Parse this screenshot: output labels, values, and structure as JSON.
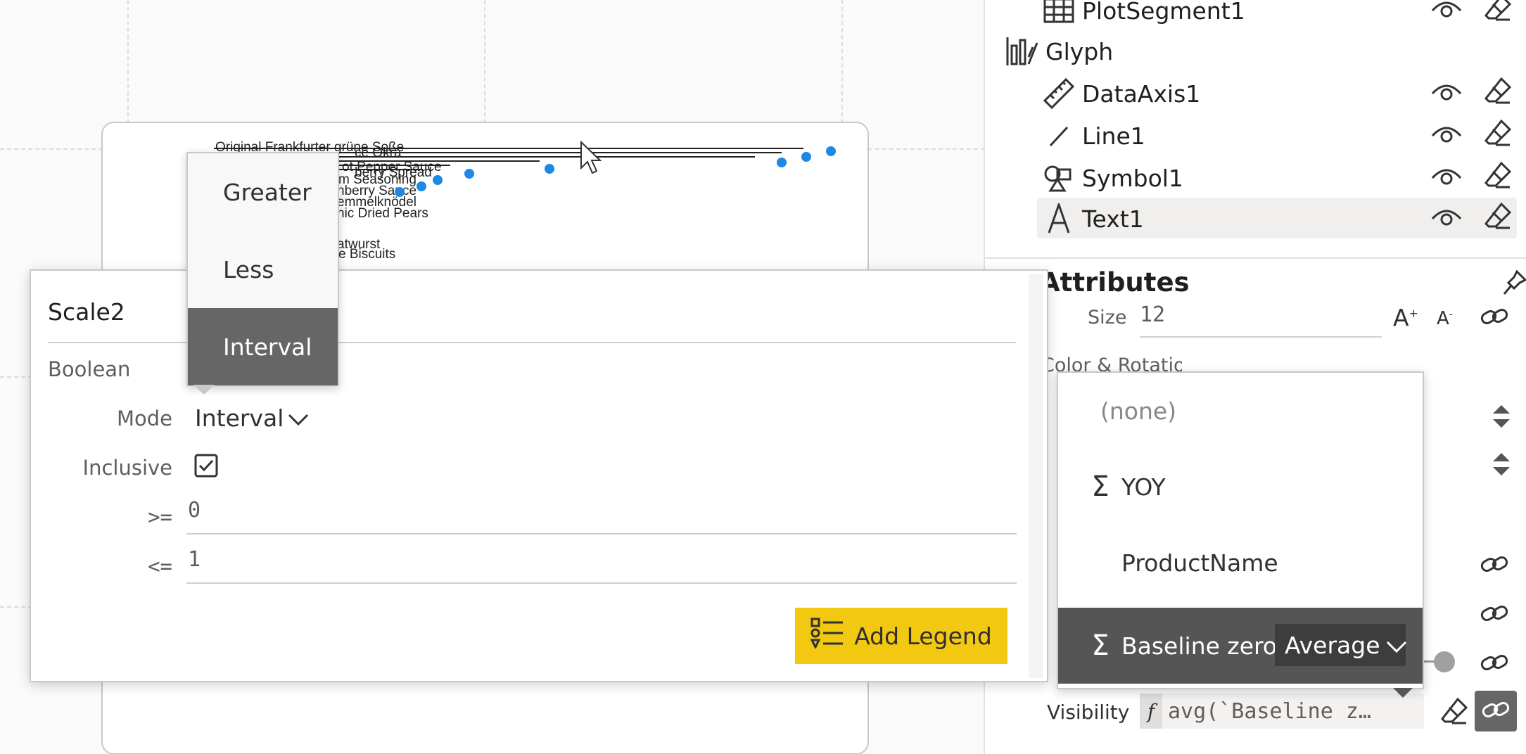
{
  "chart": {
    "labels": [
      "Original Frankfurter grüne Soße",
      "Louisiana Hot Spiced Okra",
      "Louisiana Fiery Hot Pepper Sauce",
      "Northwoods Cranberry Sauce",
      "Cajun Seasoning",
      "Cranberry Sauce",
      "Gudbrandsdalsost Semmelknödel",
      "Organic Dried Pears",
      "Thüringer Rostbratwurst",
      "Shortbread Biscuits"
    ],
    "visible_labels": [
      "Original Frankfurter grüne Soße",
      "ce Okra",
      "ot Pepper Sauce",
      "berry Spread",
      "m Seasoning",
      "nberry Sauce",
      "emmelknödel",
      "nic Dried Pears",
      "atwurst",
      "e Biscuits"
    ]
  },
  "tree": {
    "plot_segment": "PlotSegment1",
    "glyph": "Glyph",
    "items": [
      {
        "label": "DataAxis1",
        "icon": "ruler-icon"
      },
      {
        "label": "Line1",
        "icon": "line-icon"
      },
      {
        "label": "Symbol1",
        "icon": "shapes-icon"
      },
      {
        "label": "Text1",
        "icon": "text-icon"
      }
    ]
  },
  "attributes": {
    "title": "Attributes",
    "size_label": "Size",
    "size_value": "12",
    "color_rotation": "Color & Rotation",
    "visibility_label": "Visibility",
    "visibility_expr": "avg(`Baseline z…"
  },
  "scale_popup": {
    "title": "Scale2",
    "type": "Boolean",
    "mode_label": "Mode",
    "mode_value": "Interval",
    "inclusive_label": "Inclusive",
    "inclusive_checked": true,
    "gte_label": ">=",
    "gte_value": "0",
    "lte_label": "<=",
    "lte_value": "1",
    "add_legend": "Add Legend"
  },
  "mode_menu": {
    "items": [
      "Greater",
      "Less",
      "Interval"
    ],
    "selected": "Interval"
  },
  "field_menu": {
    "none": "(none)",
    "items": [
      {
        "label": "YOY",
        "numeric": true
      },
      {
        "label": "ProductName",
        "numeric": false
      },
      {
        "label": "Baseline zero",
        "numeric": true
      }
    ],
    "selected": "Baseline zero",
    "aggregation": "Average"
  },
  "colors": {
    "accent_yellow": "#f2c811",
    "selected_gray": "#666666",
    "point_blue": "#1e88e5"
  }
}
